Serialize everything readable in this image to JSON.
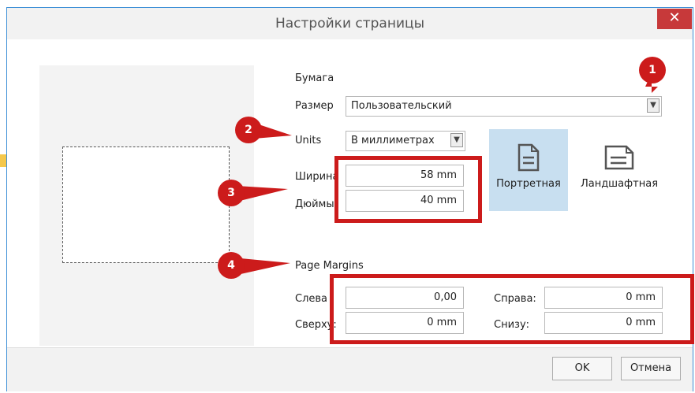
{
  "dialog": {
    "title": "Настройки страницы",
    "close_label": "✕"
  },
  "paper": {
    "section_label": "Бумага",
    "size_label": "Размер",
    "size_value": "Пользовательский",
    "units_label": "Units",
    "units_value": "В миллиметрах",
    "width_label": "Ширина",
    "width_value": "58 mm",
    "height_label": "Дюймы",
    "height_value": "40 mm"
  },
  "orientation": {
    "portrait_label": "Портретная",
    "landscape_label": "Ландшафтная",
    "selected": "portrait"
  },
  "margins": {
    "section_label": "Page Margins",
    "left_label": "Слева",
    "left_value": "0,00",
    "right_label": "Справа:",
    "right_value": "0 mm",
    "top_label": "Сверху:",
    "top_value": "0 mm",
    "bottom_label": "Снизу:",
    "bottom_value": "0 mm"
  },
  "buttons": {
    "ok_label": "OK",
    "cancel_label": "Отмена"
  },
  "annotations": {
    "badge_1": "1",
    "badge_2": "2",
    "badge_3": "3",
    "badge_4": "4"
  },
  "colors": {
    "accent_red": "#cc1b1b",
    "selected_bg": "#c8dff0",
    "close_red": "#c7393a"
  }
}
